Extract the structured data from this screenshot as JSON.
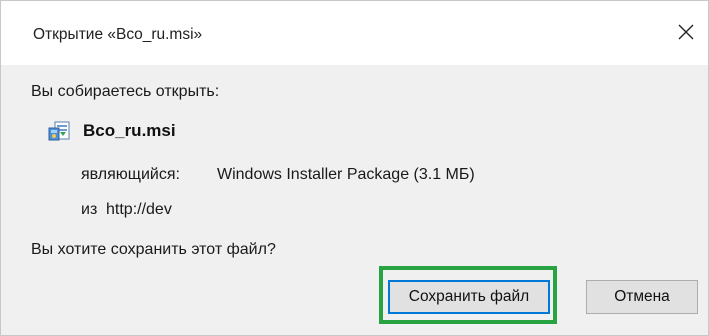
{
  "window": {
    "title": "Открытие «Bco_ru.msi»"
  },
  "content": {
    "opening_text": "Вы собираетесь открыть:",
    "file_icon": "msi-installer-icon",
    "filename": "Bco_ru.msi",
    "type_label": "являющийся:",
    "type_value": "Windows Installer Package (3.1 МБ)",
    "from_label": "из",
    "from_value": "http://dev",
    "question": "Вы хотите сохранить этот файл?"
  },
  "buttons": {
    "save_label": "Сохранить файл",
    "cancel_label": "Отмена"
  },
  "colors": {
    "highlight_frame": "#27a341",
    "default_button_border": "#0078d7"
  }
}
